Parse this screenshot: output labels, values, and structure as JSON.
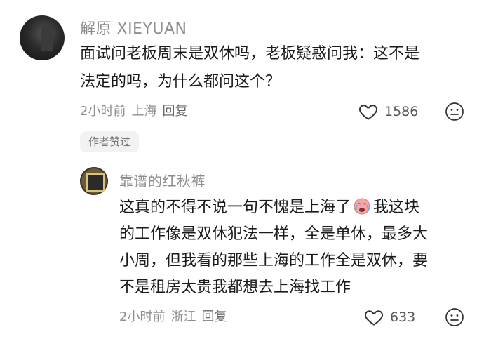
{
  "comment": {
    "username": "解原 XIEYUAN",
    "lines": [
      "面试问老板周末是双休吗，老板疑惑问我：这不是",
      "法定的吗，为什么都问这个？"
    ],
    "time": "2小时前",
    "location": "上海",
    "reply_label": "回复",
    "like_count": "1586",
    "author_badge": "作者赞过"
  },
  "reply": {
    "username": "靠谱的红秋裤",
    "line1_before_emoji": "这真的不得不说一句不愧是上海了",
    "line1_after_emoji": "我这块",
    "lines": [
      "的工作像是双休犯法一样，全是单休，最多大",
      "小周，但我看的那些上海的工作全是双休，要",
      "不是租房太贵我都想去上海找工作"
    ],
    "time": "2小时前",
    "location": "浙江",
    "reply_label": "回复",
    "like_count": "633"
  },
  "icons": {
    "like": "heart-outline-icon",
    "dislike": "meh-face-icon",
    "emoji": "crying-face-emoji"
  }
}
